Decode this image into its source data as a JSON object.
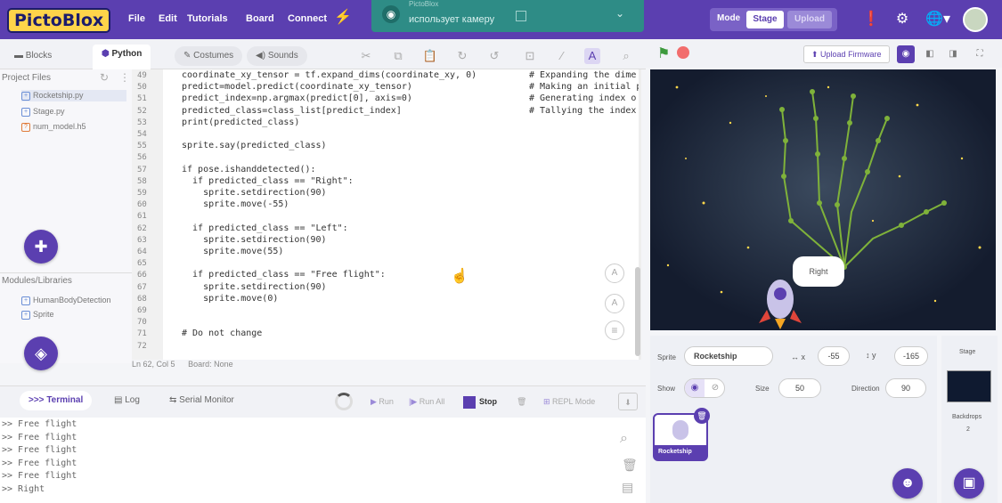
{
  "app": {
    "logo": "PictoBlox"
  },
  "menu": [
    {
      "label": "File"
    },
    {
      "label": "Edit"
    },
    {
      "label": "Tutorials"
    },
    {
      "label": "Board"
    },
    {
      "label": "Connect"
    }
  ],
  "notification": {
    "title": "PictoBlox",
    "message": "использует камеру"
  },
  "mode": {
    "label": "Mode",
    "stage": "Stage",
    "upload": "Upload"
  },
  "tabs": {
    "blocks": "Blocks",
    "python": "Python",
    "costumes": "Costumes",
    "sounds": "Sounds"
  },
  "project_files": {
    "title": "Project Files",
    "items": [
      "Rocketship.py",
      "Stage.py",
      "num_model.h5"
    ]
  },
  "modules": {
    "title": "Modules/Libraries",
    "items": [
      "HumanBodyDetection",
      "Sprite"
    ]
  },
  "code": {
    "line_numbers": [
      "49",
      "50",
      "51",
      "52",
      "53",
      "54",
      "55",
      "56",
      "57",
      "58",
      "59",
      "60",
      "61",
      "62",
      "63",
      "64",
      "65",
      "66",
      "67",
      "68",
      "69",
      "70",
      "71",
      "72"
    ],
    "lines": [
      "coordinate_xy_tensor = tf.expand_dims(coordinate_xy, 0)",
      "predict=model.predict(coordinate_xy_tensor)",
      "predict_index=np.argmax(predict[0], axis=0)",
      "predicted_class=class_list[predict_index]",
      "print(predicted_class)",
      "",
      "sprite.say(predicted_class)",
      "",
      "if pose.ishanddetected():",
      "  if predicted_class == \"Right\":",
      "    sprite.setdirection(90)",
      "    sprite.move(-55)",
      "",
      "  if predicted_class == \"Left\":",
      "    sprite.setdirection(90)",
      "    sprite.move(55)",
      "",
      "  if predicted_class == \"Free flight\":",
      "    sprite.setdirection(90)",
      "    sprite.move(0)",
      "",
      "",
      "# Do not change",
      ""
    ],
    "comments": [
      "# Expanding the dime",
      "# Making an initial p",
      "# Generating index o",
      "# Tallying the index"
    ]
  },
  "status": {
    "position": "Ln 62, Col 5",
    "board": "Board: None"
  },
  "terminal": {
    "tabs": {
      "terminal": "Terminal",
      "log": "Log",
      "serial": "Serial Monitor"
    },
    "buttons": {
      "run": "Run",
      "run_all": "Run All",
      "stop": "Stop",
      "repl": "REPL Mode"
    },
    "lines": [
      ">> Free flight",
      ">> Free flight",
      ">> Free flight",
      ">> Free flight",
      ">> Free flight",
      ">> Right"
    ]
  },
  "stage_bar": {
    "upload_firmware": "Upload Firmware"
  },
  "stage": {
    "speech": "Right"
  },
  "sprite": {
    "label": "Sprite",
    "name": "Rocketship",
    "x_label": "x",
    "x": "-55",
    "y_label": "y",
    "y": "-165",
    "show_label": "Show",
    "size_label": "Size",
    "size": "50",
    "direction_label": "Direction",
    "direction": "90",
    "thumb": "Rocketship"
  },
  "stage_panel": {
    "title": "Stage",
    "backdrops_label": "Backdrops",
    "backdrops": "2"
  },
  "colors": {
    "brand": "#5b3fb0",
    "toast": "#2e8c86",
    "stage_bg": "#141c2e",
    "hand": "#7fb23a",
    "stop": "#5b3fb0"
  }
}
